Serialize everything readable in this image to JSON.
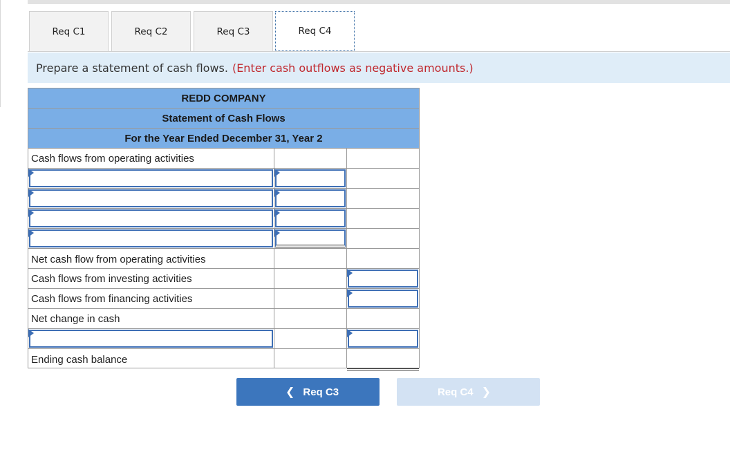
{
  "tabs": [
    {
      "label": "Req C1",
      "active": false
    },
    {
      "label": "Req C2",
      "active": false
    },
    {
      "label": "Req C3",
      "active": false
    },
    {
      "label": "Req C4",
      "active": true
    }
  ],
  "instruction": {
    "text": "Prepare a statement of cash flows.",
    "note": "(Enter cash outflows as negative amounts.)"
  },
  "statement": {
    "company": "REDD COMPANY",
    "title": "Statement of Cash Flows",
    "period": "For the Year Ended December 31, Year 2",
    "labels": {
      "operating": "Cash flows from operating activities",
      "net_operating": "Net cash flow from operating activities",
      "investing": "Cash flows from investing activities",
      "financing": "Cash flows from financing activities",
      "net_change": "Net change in cash",
      "ending": "Ending cash balance"
    }
  },
  "nav": {
    "prev_label": "Req C3",
    "next_label": "Req C4",
    "prev_icon": "chevron-left-icon",
    "next_icon": "chevron-right-icon",
    "next_disabled": true
  },
  "colors": {
    "header_blue": "#7aaee6",
    "instruction_bg": "#dfedf8",
    "note_red": "#c0272d",
    "input_border": "#3e6fb5",
    "prev_button": "#3c76bd",
    "next_button_disabled": "#d3e2f3"
  }
}
